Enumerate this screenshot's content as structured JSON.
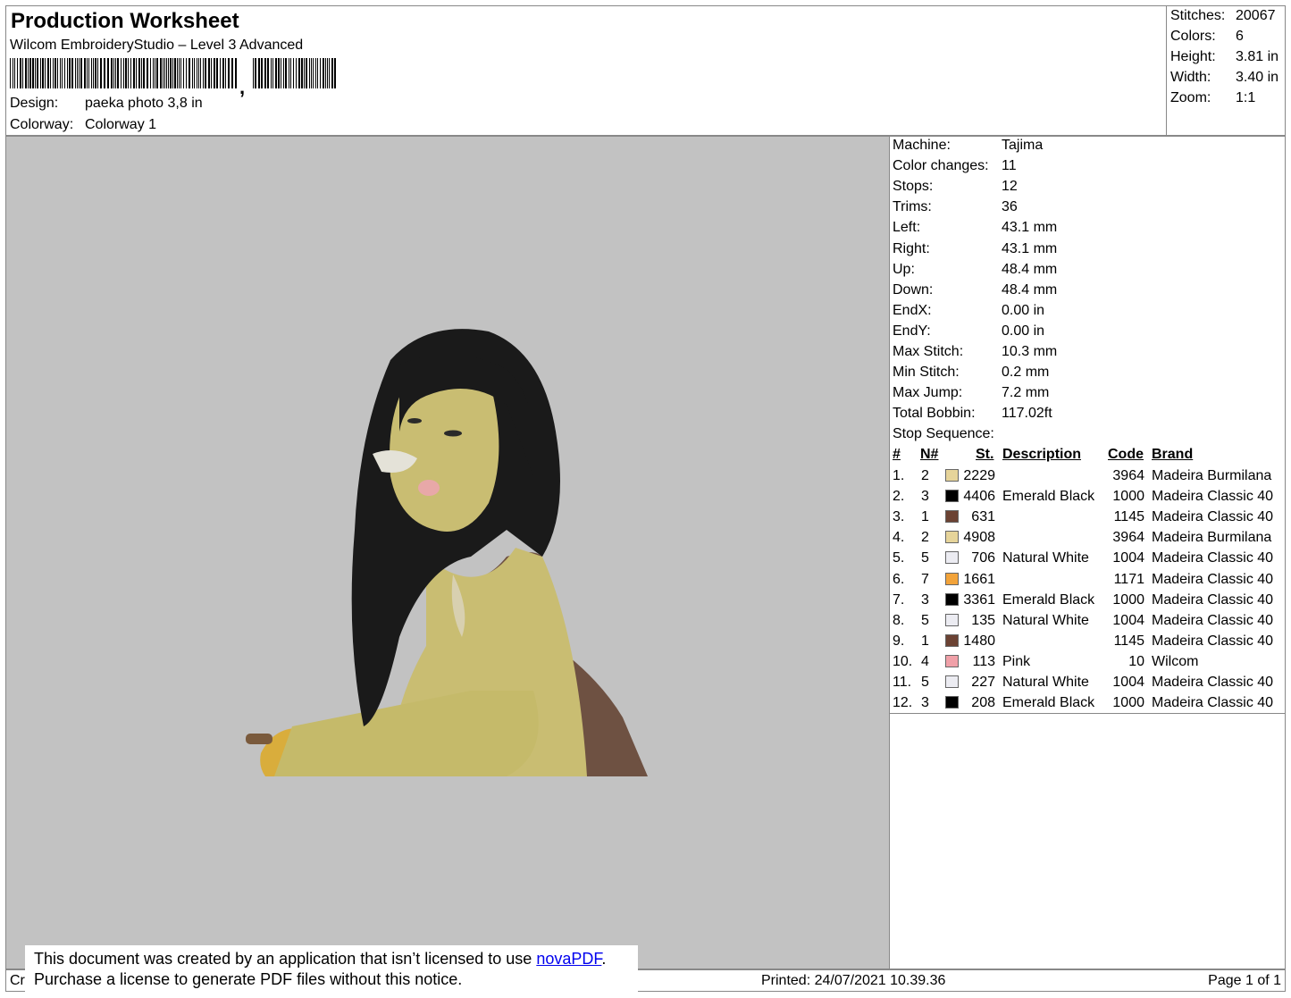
{
  "header": {
    "title": "Production Worksheet",
    "subtitle": "Wilcom EmbroideryStudio – Level 3 Advanced",
    "design_label": "Design:",
    "design_value": "paeka photo 3,8 in",
    "colorway_label": "Colorway:",
    "colorway_value": "Colorway 1"
  },
  "summary": {
    "stitches_label": "Stitches:",
    "stitches": "20067",
    "colors_label": "Colors:",
    "colors": "6",
    "height_label": "Height:",
    "height": "3.81 in",
    "width_label": "Width:",
    "width": "3.40 in",
    "zoom_label": "Zoom:",
    "zoom": "1:1"
  },
  "specs": [
    {
      "label": "Machine:",
      "value": "Tajima"
    },
    {
      "label": "Color changes:",
      "value": "11"
    },
    {
      "label": "Stops:",
      "value": "12"
    },
    {
      "label": "Trims:",
      "value": "36"
    },
    {
      "label": "Left:",
      "value": "43.1 mm"
    },
    {
      "label": "Right:",
      "value": "43.1 mm"
    },
    {
      "label": "Up:",
      "value": "48.4 mm"
    },
    {
      "label": "Down:",
      "value": "48.4 mm"
    },
    {
      "label": "EndX:",
      "value": "0.00 in"
    },
    {
      "label": "EndY:",
      "value": "0.00 in"
    },
    {
      "label": "Max Stitch:",
      "value": "10.3 mm"
    },
    {
      "label": "Min Stitch:",
      "value": "0.2 mm"
    },
    {
      "label": "Max Jump:",
      "value": "7.2 mm"
    },
    {
      "label": "Total Bobbin:",
      "value": "117.02ft"
    }
  ],
  "stop_sequence": {
    "title": "Stop Sequence:",
    "headers": {
      "num": "#",
      "needle": "N#",
      "st": "St.",
      "description": "Description",
      "code": "Code",
      "brand": "Brand"
    },
    "rows": [
      {
        "num": "1.",
        "needle": "2",
        "color": "#e6d49a",
        "st": "2229",
        "description": "",
        "code": "3964",
        "brand": "Madeira Burmilana"
      },
      {
        "num": "2.",
        "needle": "3",
        "color": "#000000",
        "st": "4406",
        "description": "Emerald Black",
        "code": "1000",
        "brand": "Madeira Classic 40"
      },
      {
        "num": "3.",
        "needle": "1",
        "color": "#6b4233",
        "st": "631",
        "description": "",
        "code": "1145",
        "brand": "Madeira Classic 40"
      },
      {
        "num": "4.",
        "needle": "2",
        "color": "#e6d49a",
        "st": "4908",
        "description": "",
        "code": "3964",
        "brand": "Madeira Burmilana"
      },
      {
        "num": "5.",
        "needle": "5",
        "color": "#ececf2",
        "st": "706",
        "description": "Natural White",
        "code": "1004",
        "brand": "Madeira Classic 40"
      },
      {
        "num": "6.",
        "needle": "7",
        "color": "#f2a33a",
        "st": "1661",
        "description": "",
        "code": "1171",
        "brand": "Madeira Classic 40"
      },
      {
        "num": "7.",
        "needle": "3",
        "color": "#000000",
        "st": "3361",
        "description": "Emerald Black",
        "code": "1000",
        "brand": "Madeira Classic 40"
      },
      {
        "num": "8.",
        "needle": "5",
        "color": "#ececf2",
        "st": "135",
        "description": "Natural White",
        "code": "1004",
        "brand": "Madeira Classic 40"
      },
      {
        "num": "9.",
        "needle": "1",
        "color": "#6b4233",
        "st": "1480",
        "description": "",
        "code": "1145",
        "brand": "Madeira Classic 40"
      },
      {
        "num": "10.",
        "needle": "4",
        "color": "#f0a0a8",
        "st": "113",
        "description": "Pink",
        "code": "10",
        "brand": "Wilcom"
      },
      {
        "num": "11.",
        "needle": "5",
        "color": "#ececf2",
        "st": "227",
        "description": "Natural White",
        "code": "1004",
        "brand": "Madeira Classic 40"
      },
      {
        "num": "12.",
        "needle": "3",
        "color": "#000000",
        "st": "208",
        "description": "Emerald Black",
        "code": "1000",
        "brand": "Madeira Classic 40"
      }
    ]
  },
  "footer": {
    "created_truncated": "Cr",
    "printed": "Printed: 24/07/2021 10.39.36",
    "page": "Page 1 of 1"
  },
  "notice": {
    "line1_prefix": "This document was created by an application that isn’t licensed to use ",
    "link": "novaPDF",
    "line1_suffix": ".",
    "line2": "Purchase a license to generate PDF files without this notice."
  },
  "colors": {
    "preview_bg": "#c2c2c2",
    "skin": "#c9bd72",
    "hair": "#1a1a1a",
    "top": "#6e5142",
    "hand": "#d9ad3c"
  }
}
